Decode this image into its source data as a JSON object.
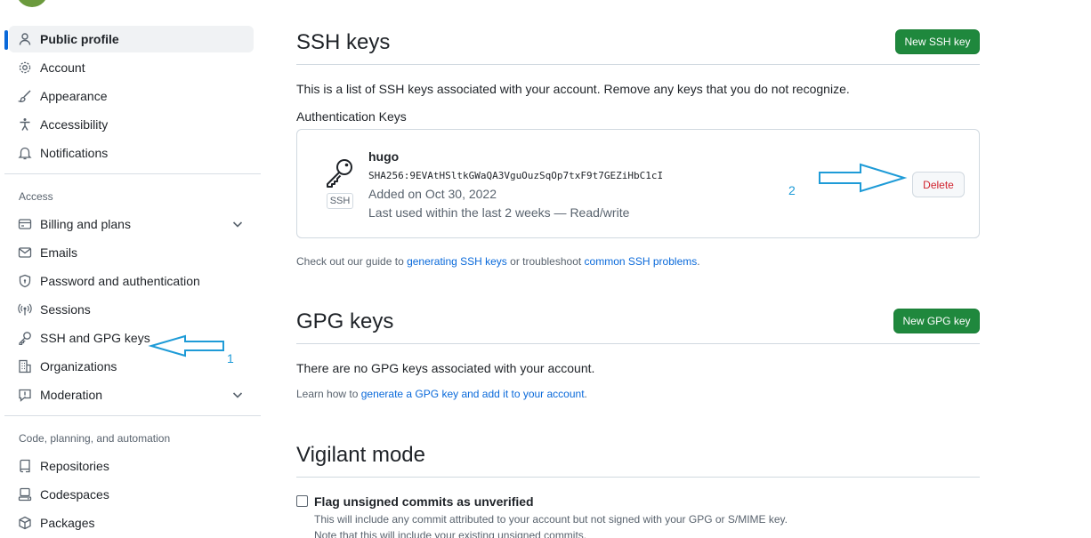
{
  "sidebar": {
    "items": [
      {
        "label": "Public profile",
        "icon": "person-icon",
        "active": true
      },
      {
        "label": "Account",
        "icon": "gear-icon"
      },
      {
        "label": "Appearance",
        "icon": "paintbrush-icon"
      },
      {
        "label": "Accessibility",
        "icon": "accessibility-icon"
      },
      {
        "label": "Notifications",
        "icon": "bell-icon"
      }
    ],
    "access_heading": "Access",
    "access_items": [
      {
        "label": "Billing and plans",
        "icon": "credit-card-icon",
        "expandable": true
      },
      {
        "label": "Emails",
        "icon": "mail-icon"
      },
      {
        "label": "Password and authentication",
        "icon": "shield-lock-icon"
      },
      {
        "label": "Sessions",
        "icon": "broadcast-icon"
      },
      {
        "label": "SSH and GPG keys",
        "icon": "key-icon"
      },
      {
        "label": "Organizations",
        "icon": "organization-icon"
      },
      {
        "label": "Moderation",
        "icon": "report-icon",
        "expandable": true
      }
    ],
    "code_heading": "Code, planning, and automation",
    "code_items": [
      {
        "label": "Repositories",
        "icon": "repo-icon"
      },
      {
        "label": "Codespaces",
        "icon": "codespaces-icon"
      },
      {
        "label": "Packages",
        "icon": "package-icon"
      }
    ]
  },
  "ssh": {
    "title": "SSH keys",
    "new_button": "New SSH key",
    "description": "This is a list of SSH keys associated with your account. Remove any keys that you do not recognize.",
    "auth_heading": "Authentication Keys",
    "key": {
      "name": "hugo",
      "fingerprint": "SHA256:9EVAtHSltkGWaQA3VguOuzSqOp7txF9t7GEZiHbC1cI",
      "added": "Added on Oct 30, 2022",
      "last_used": "Last used within the last 2 weeks — Read/write",
      "tag": "SSH",
      "delete_button": "Delete"
    },
    "guide_prefix": "Check out our guide to ",
    "guide_link1": "generating SSH keys",
    "guide_middle": " or troubleshoot ",
    "guide_link2": "common SSH problems",
    "guide_suffix": "."
  },
  "gpg": {
    "title": "GPG keys",
    "new_button": "New GPG key",
    "empty_text": "There are no GPG keys associated with your account.",
    "learn_prefix": "Learn how to ",
    "learn_link": "generate a GPG key and add it to your account",
    "learn_suffix": "."
  },
  "vigilant": {
    "title": "Vigilant mode",
    "checkbox_label": "Flag unsigned commits as unverified",
    "help1": "This will include any commit attributed to your account but not signed with your GPG or S/MIME key.",
    "help2": "Note that this will include your existing unsigned commits."
  },
  "annotations": {
    "step1": "1",
    "step2": "2",
    "color": "#1e9bd7"
  }
}
